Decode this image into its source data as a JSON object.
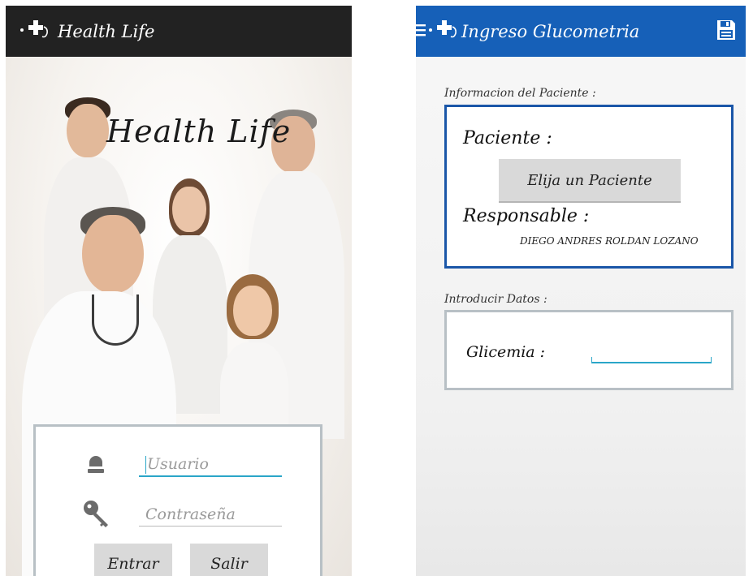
{
  "login_screen": {
    "appbar": {
      "title": "Health Life",
      "logo_icon": "medical-cross-icon"
    },
    "hero_title": "Health Life",
    "username": {
      "placeholder": "Usuario",
      "icon": "user-icon"
    },
    "password": {
      "placeholder": "Contraseña",
      "icon": "key-icon"
    },
    "buttons": {
      "enter": "Entrar",
      "exit": "Salir"
    },
    "colors": {
      "appbar": "#222222",
      "accent": "#2aa6c8"
    }
  },
  "glucometry_screen": {
    "appbar": {
      "title": "Ingreso Glucometria",
      "menu_icon": "hamburger-menu-icon",
      "logo_icon": "medical-cross-icon",
      "save_icon": "floppy-save-icon"
    },
    "patient_section": {
      "label": "Informacion del Paciente :",
      "patient_label": "Paciente :",
      "choose_button": "Elija un Paciente",
      "responsible_label": "Responsable :",
      "responsible_name": "DIEGO ANDRES ROLDAN LOZANO"
    },
    "data_section": {
      "label": "Introducir Datos :",
      "glycemia_label": "Glicemia :",
      "glycemia_value": ""
    },
    "colors": {
      "appbar": "#1660b8",
      "card_border": "#1a56a8"
    }
  }
}
